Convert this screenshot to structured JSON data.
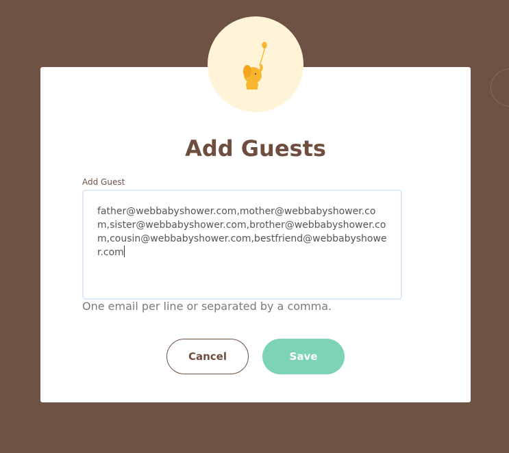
{
  "modal": {
    "title": "Add Guests",
    "field_label": "Add Guest",
    "textarea_value": "father@webbabyshower.com,mother@webbabyshower.com,sister@webbabyshower.com,brother@webbabyshower.com,cousin@webbabyshower.com,bestfriend@webbabyshower.com",
    "hint": "One email per line or separated by a comma.",
    "cancel_label": "Cancel",
    "save_label": "Save"
  },
  "logo": {
    "icon": "elephant-balloon-icon"
  },
  "colors": {
    "background": "#6e5243",
    "brand_brown": "#6e4e3e",
    "save_button": "#7dd3b8",
    "logo_badge": "#fff4d8",
    "logo_icon": "#f7b530"
  }
}
